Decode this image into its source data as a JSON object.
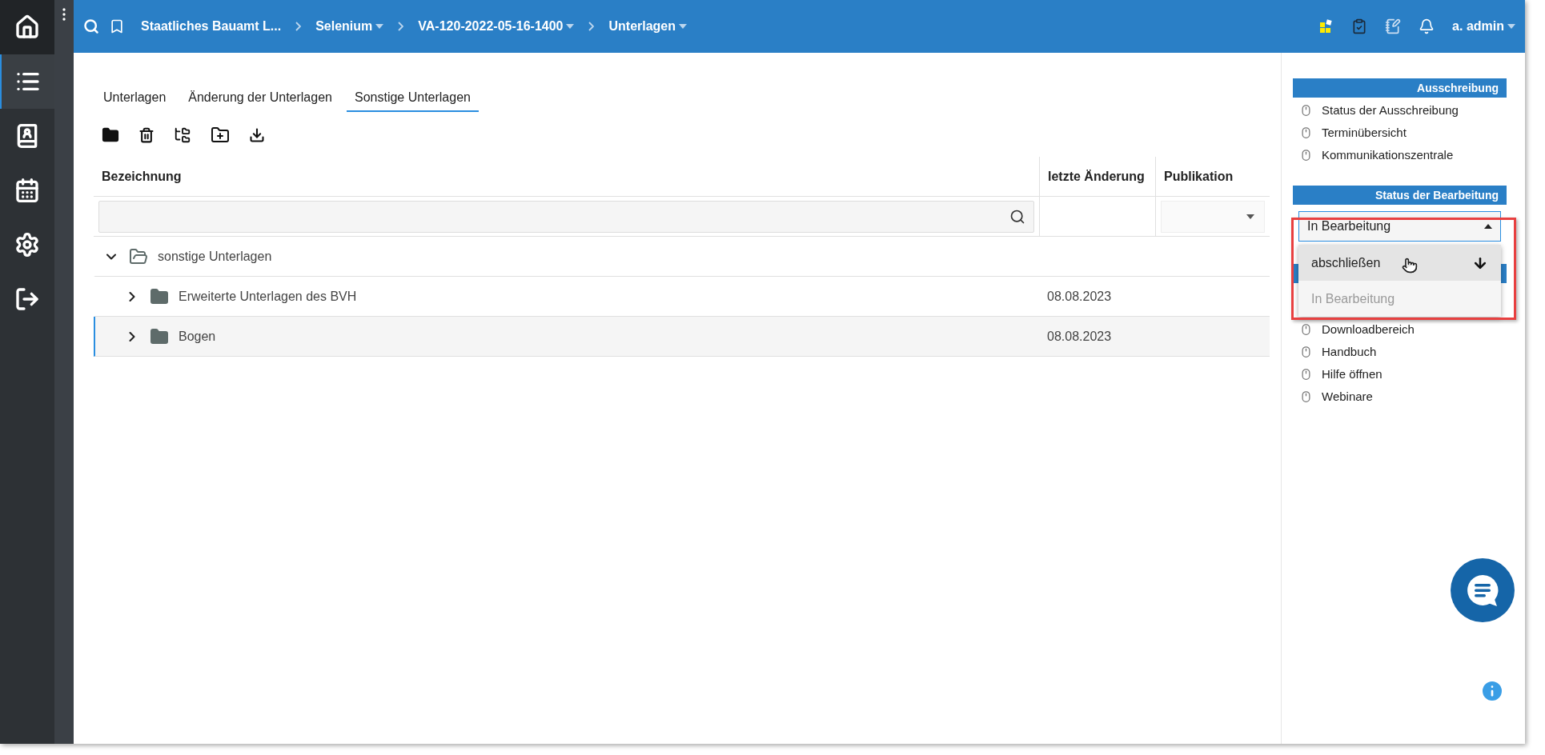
{
  "nav": [
    {
      "selected": false
    },
    {
      "selected": true
    },
    {
      "selected": false
    },
    {
      "selected": false
    },
    {
      "selected": false
    },
    {
      "selected": false
    }
  ],
  "breadcrumb": [
    {
      "label": "Staatliches Bauamt L...",
      "dropdown": false
    },
    {
      "label": "Selenium",
      "dropdown": true
    },
    {
      "label": "VA-120-2022-05-16-1400",
      "dropdown": true
    },
    {
      "label": "Unterlagen",
      "dropdown": true
    }
  ],
  "user": {
    "name": "a. admin"
  },
  "tabs": [
    {
      "label": "Unterlagen",
      "selected": false
    },
    {
      "label": "Änderung der Unterlagen",
      "selected": false
    },
    {
      "label": "Sonstige Unterlagen",
      "selected": true
    }
  ],
  "table": {
    "columns": [
      "Bezeichnung",
      "letzte Änderung",
      "Publikation"
    ],
    "rows": [
      {
        "name": "sonstige Unterlagen",
        "date": "",
        "expanded": true,
        "selected": false,
        "children": [
          {
            "name": "Erweiterte Unterlagen des BVH",
            "date": "08.08.2023",
            "expanded": false,
            "selected": false
          },
          {
            "name": "Bogen",
            "date": "08.08.2023",
            "expanded": false,
            "selected": true
          }
        ]
      }
    ]
  },
  "panel": {
    "ausschreibung": {
      "title": "Ausschreibung",
      "links": [
        "Status der Ausschreibung",
        "Terminübersicht",
        "Kommunikationszentrale"
      ]
    },
    "status": {
      "title": "Status der Bearbeitung",
      "value": "In Bearbeitung",
      "open": true,
      "options": [
        {
          "label": "abschließen",
          "hovered": true,
          "disabled": false
        },
        {
          "label": "In Bearbeitung",
          "hovered": false,
          "disabled": true
        }
      ]
    },
    "help_links": [
      "Downloadbereich",
      "Handbuch",
      "Hilfe öffnen",
      "Webinare"
    ]
  }
}
